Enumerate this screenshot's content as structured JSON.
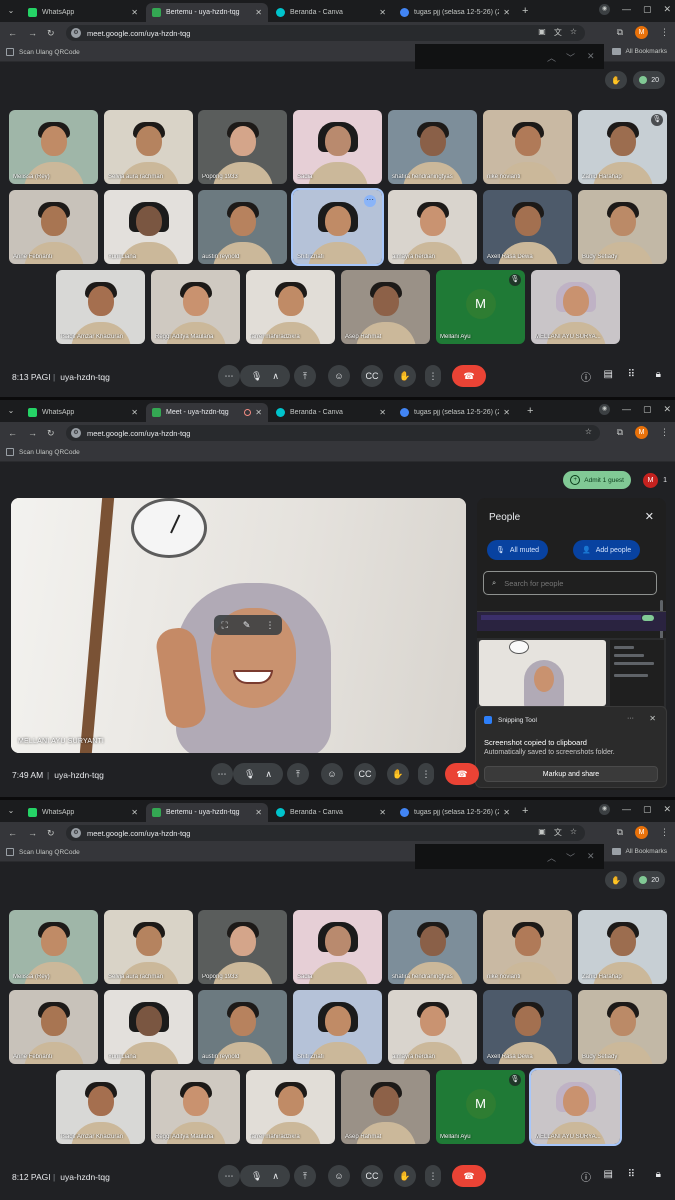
{
  "browser": {
    "tabs_a": [
      "WhatsApp",
      "Bertemu - uya-hzdn-tqg",
      "Beranda - Canva",
      "tugas pjj (selasa 12-5-26) (29 x"
    ],
    "tabs_b": [
      "WhatsApp",
      "Meet - uya-hzdn-tqg",
      "Beranda - Canva",
      "tugas pjj (selasa 12-5-26) (29 x"
    ],
    "url": "meet.google.com/uya-hzdn-tqg",
    "bookmark": "Scan Ulang QRCode",
    "all_bookmarks": "All Bookmarks",
    "profile_initial": "M"
  },
  "meeting": {
    "code": "uya-hzdn-tqg",
    "count_grid": "20",
    "count_speaker": "1",
    "shot1_time": "8:13 PAGI",
    "shot2_time": "7:49 AM",
    "shot3_time": "8:12 PAGI",
    "admit_label": "Admit 1 guest",
    "participants": [
      "Melissa (Rey)",
      "Selvia aura rachman",
      "Popong 1933",
      "Sadia",
      "shafira hendraningtyas",
      "nike novianti",
      "Zahid Harahap",
      "Anne Febrianti",
      "Yuni Liana",
      "austin reynold",
      "Shiti Zhafi",
      "almayra herdian",
      "Axell Rasa Dewa",
      "Budy Setiady",
      "Tsaqif Amzar Khaizuran",
      "Reggi Aditya Maulana",
      "farrel mahiradzikra",
      "Asep Rahmat",
      "Mellani Ayu",
      "MELLANI AYU SURYA..."
    ],
    "avatar_letter": "M",
    "speaker_name": "MELLANI AYU SURYANTI"
  },
  "people_panel": {
    "title": "People",
    "all_muted": "All muted",
    "add_people": "Add people",
    "search_placeholder": "Search for people"
  },
  "snipping": {
    "app": "Snipping Tool",
    "title": "Screenshot copied to clipboard",
    "subtitle": "Automatically saved to screenshots folder.",
    "button": "Markup and share"
  },
  "colors": {
    "end_call": "#ea4335",
    "admit": "#81c995",
    "panel_button": "#0842a0"
  }
}
